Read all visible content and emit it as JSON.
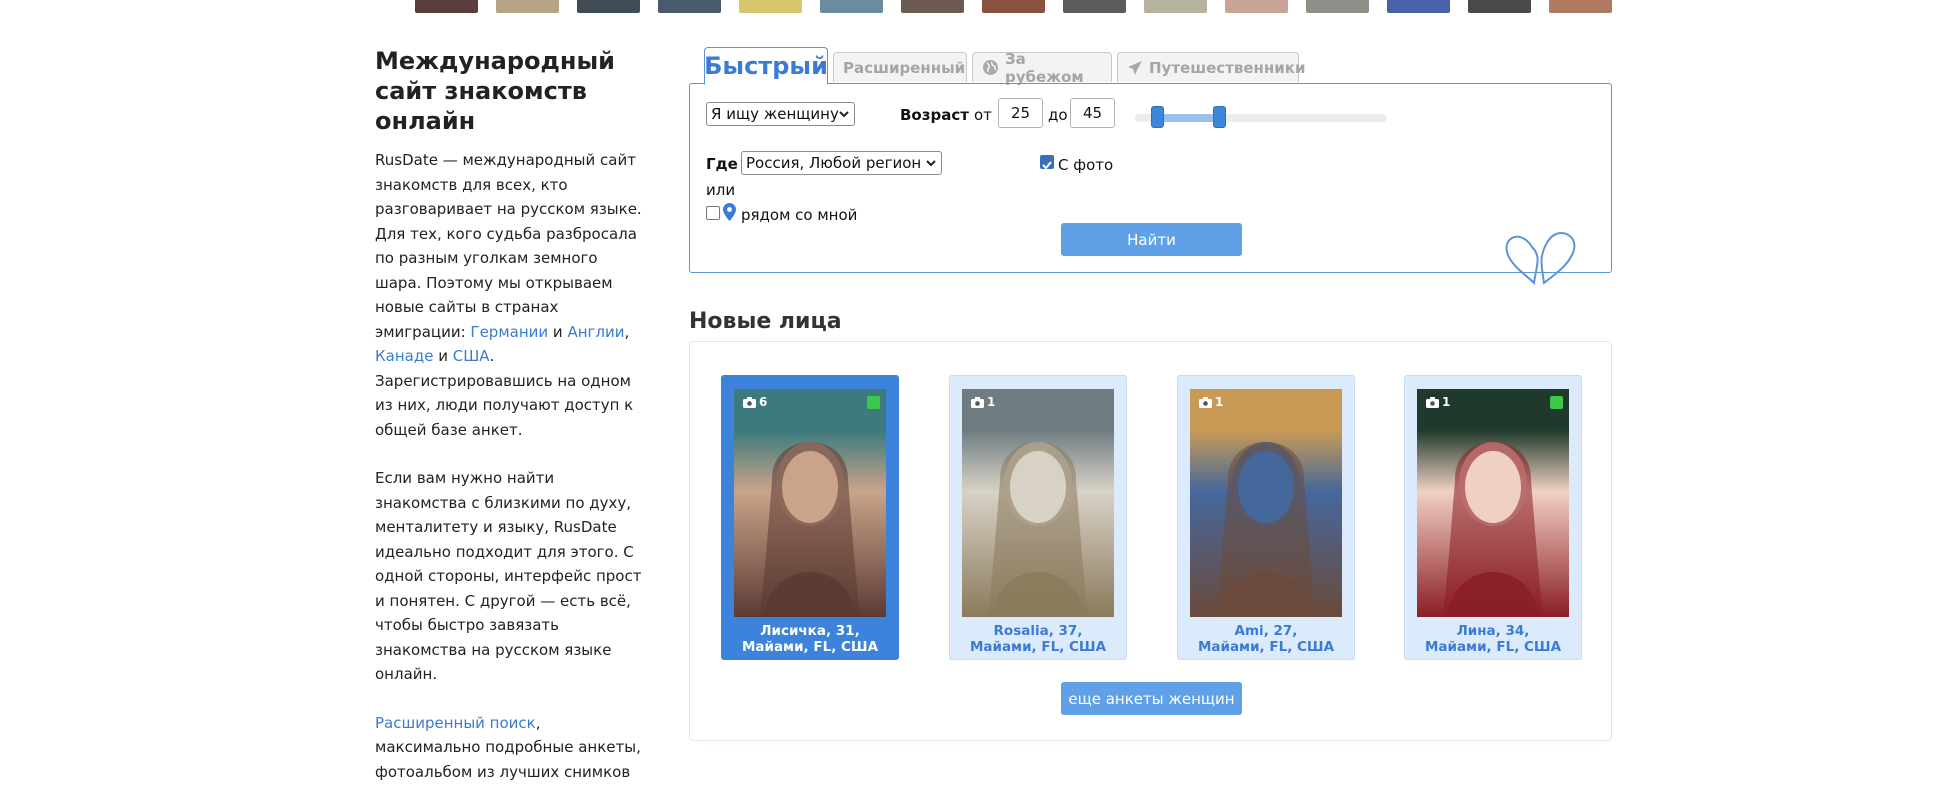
{
  "top_strip": {
    "thumb_colors": [
      "#5a3d3d",
      "#b7a487",
      "#3f4c55",
      "#4a5a6d",
      "#d7c66b",
      "#6b8ba1",
      "#6c5a52",
      "#8a5140",
      "#5c5c5c",
      "#b7b29e",
      "#c9a496",
      "#8c9086",
      "#4762a8",
      "#4a4a4a",
      "#b07a60"
    ]
  },
  "left": {
    "title": "Международный сайт знакомств онлайн",
    "p1_text_before": "RusDate — международный сайт знакомств для всех, кто разговаривает на русском языке. Для тех, кого судьба разбросала по разным уголкам земного шара. Поэтому мы открываем новые сайты в странах эмиграции: ",
    "link_germany": "Германии",
    "and1": " и ",
    "link_england": "Англии",
    "comma": ", ",
    "link_canada": "Канаде",
    "and2": " и ",
    "link_usa": "США",
    "p1_text_after": ". Зарегистрировавшись на одном из них, люди получают доступ к общей базе анкет.",
    "p2": "Если вам нужно найти знакомства с близкими по духу, менталитету и языку, RusDate идеально подходит для этого. С одной стороны, интерфейс прост и понятен. С другой — есть всё, чтобы быстро завязать знакомства на русском языке онлайн.",
    "link_advanced": "Расширенный поиск",
    "p3_text": ", максимально подробные анкеты, фотоальбом из лучших снимков"
  },
  "tabs": [
    {
      "label": "Быстрый",
      "icon": "",
      "active": true
    },
    {
      "label": "Расширенный",
      "icon": "",
      "active": false
    },
    {
      "label": "За рубежом",
      "icon": "globe-icon",
      "active": false
    },
    {
      "label": "Путешественники",
      "icon": "plane-icon",
      "active": false
    }
  ],
  "search": {
    "looking_for": "Я ищу женщину",
    "age_label": "Возраст",
    "from_label": "от",
    "age_from": "25",
    "to_label": "до",
    "age_to": "45",
    "slider": {
      "min": 18,
      "max": 99,
      "from": 25,
      "to": 45
    },
    "where_label": "Где",
    "where_value": "Россия, Любой регион",
    "with_photo_label": "С фото",
    "with_photo_checked": true,
    "or_label": "или",
    "near_me_label": "рядом со мной",
    "near_me_checked": false,
    "find_button": "Найти",
    "accent_color": "#5e93d8"
  },
  "new_faces": {
    "title": "Новые лица",
    "cards": [
      {
        "name": "Лисичка, 31,",
        "location": "Майами, FL, США",
        "photos": "6",
        "online": true,
        "active": true,
        "photo_palette": [
          "#3d7a7d",
          "#c9a48a",
          "#5b3a33"
        ]
      },
      {
        "name": "Rosalia, 37,",
        "location": "Майами, FL, США",
        "photos": "1",
        "online": false,
        "active": false,
        "photo_palette": [
          "#6f7d82",
          "#d8d2c6",
          "#8b7a5c"
        ]
      },
      {
        "name": "Ami, 27,",
        "location": "Майами, FL, США",
        "photos": "1",
        "online": false,
        "active": false,
        "photo_palette": [
          "#c99a55",
          "#45689c",
          "#6b4a3b"
        ]
      },
      {
        "name": "Лина, 34,",
        "location": "Майами, FL, США",
        "photos": "1",
        "online": true,
        "active": false,
        "photo_palette": [
          "#1f3a2c",
          "#f1d0c4",
          "#8a1e24"
        ]
      }
    ],
    "more_button": "еще анкеты женщин"
  }
}
